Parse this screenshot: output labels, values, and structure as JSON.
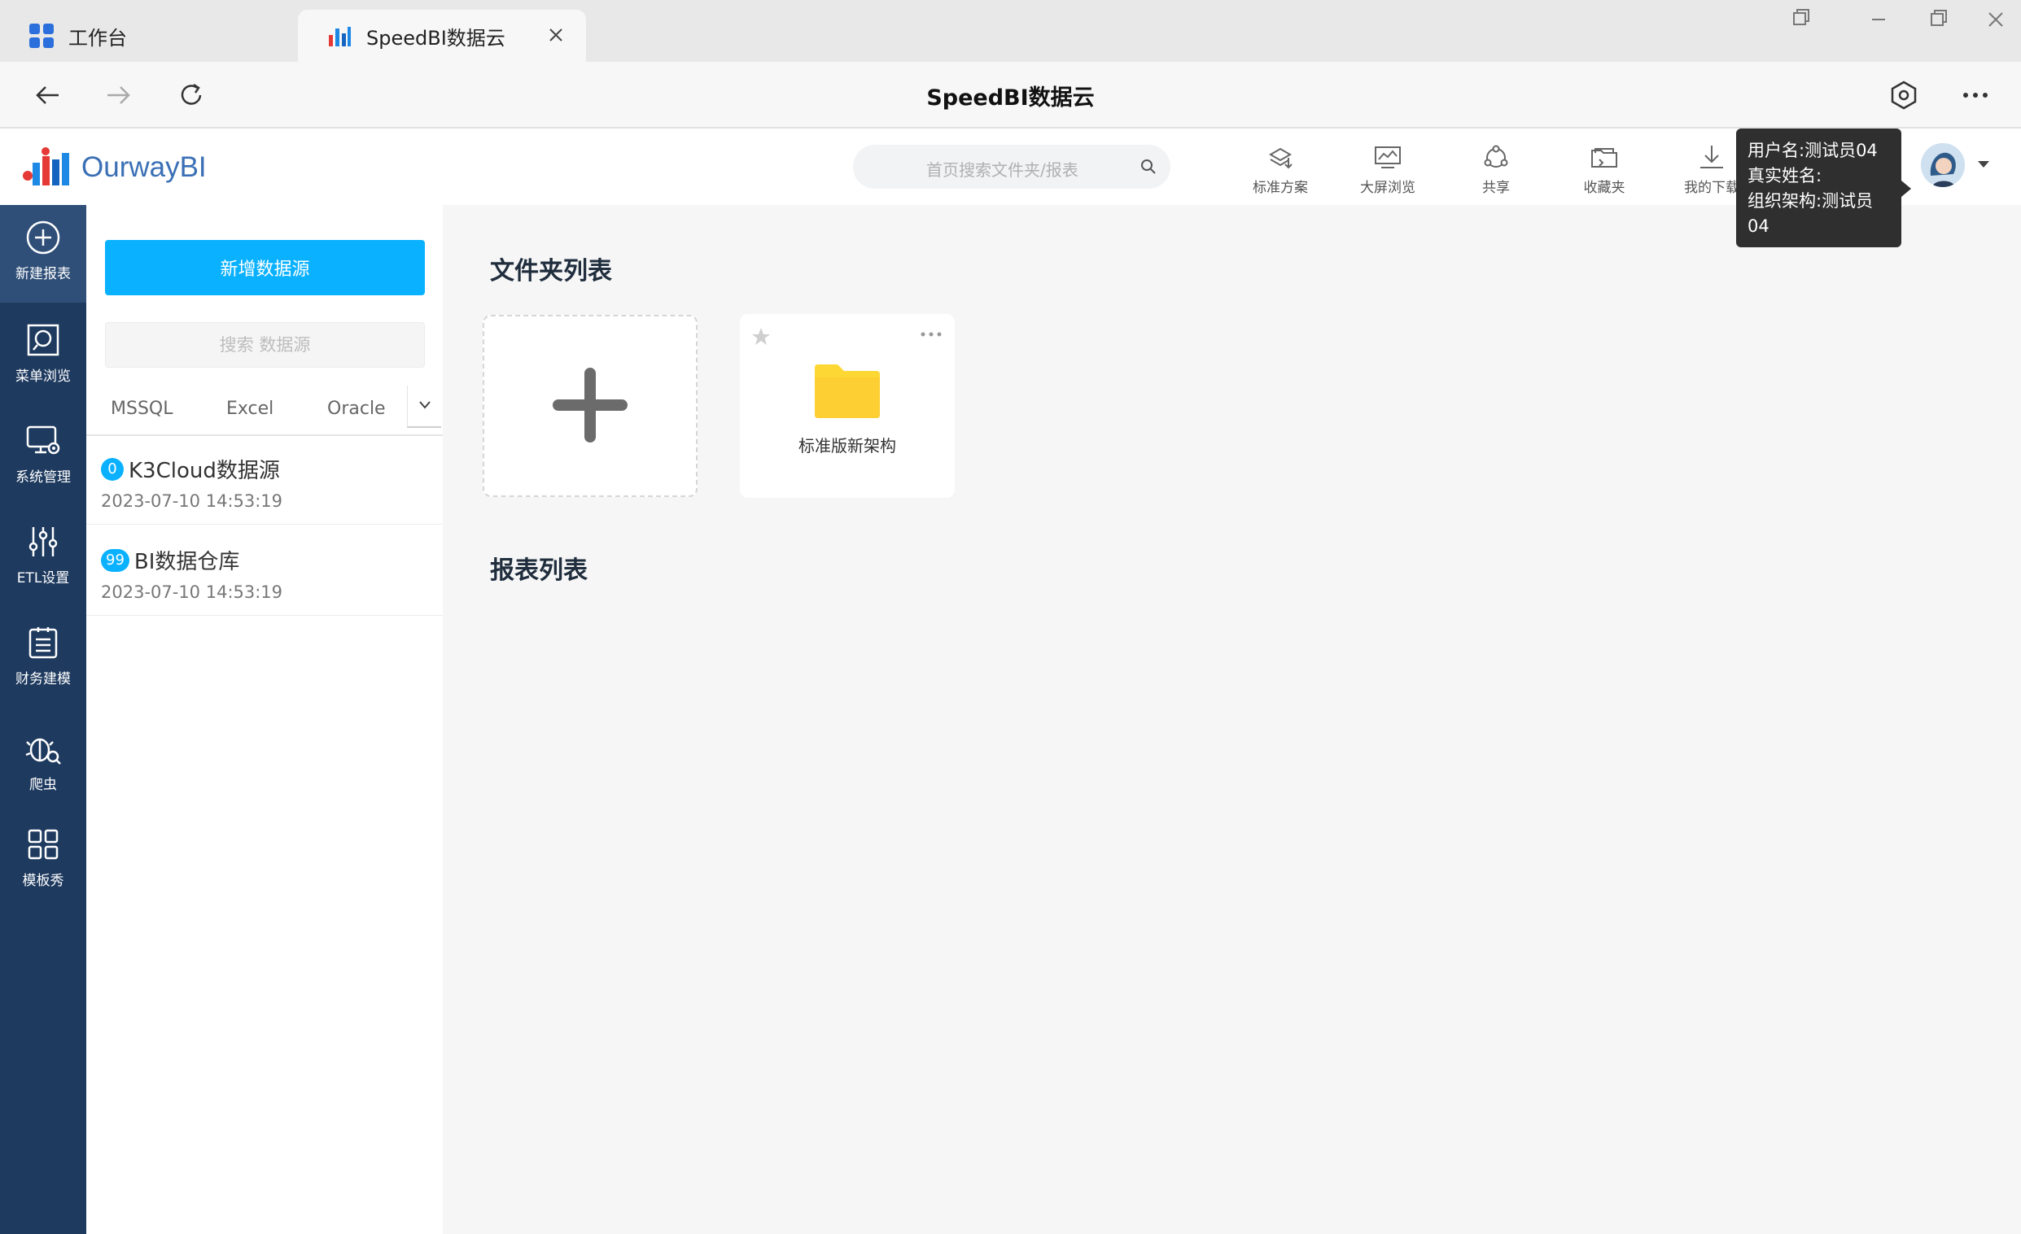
{
  "browser": {
    "tabs": [
      {
        "label": "工作台",
        "icon": "grid-app-icon"
      },
      {
        "label": "SpeedBI数据云",
        "icon": "speedbi-logo-icon"
      }
    ],
    "page_title": "SpeedBI数据云"
  },
  "header": {
    "logo_text": "OurwayBI",
    "search_placeholder": "首页搜索文件夹/报表",
    "tools": [
      {
        "label": "标准方案",
        "icon": "layers-download-icon"
      },
      {
        "label": "大屏浏览",
        "icon": "monitor-chart-icon"
      },
      {
        "label": "共享",
        "icon": "share-icon"
      },
      {
        "label": "收藏夹",
        "icon": "folder-heart-icon"
      },
      {
        "label": "我的下载",
        "icon": "download-icon"
      }
    ]
  },
  "tooltip": {
    "username": "用户名:测试员04",
    "realname": "真实姓名:",
    "org": "组织架构:测试员04"
  },
  "rail": {
    "items": [
      {
        "label": "新建报表",
        "icon": "plus-circle-icon",
        "active": true
      },
      {
        "label": "菜单浏览",
        "icon": "search-square-icon"
      },
      {
        "label": "系统管理",
        "icon": "monitor-gear-icon"
      },
      {
        "label": "ETL设置",
        "icon": "sliders-icon"
      },
      {
        "label": "财务建模",
        "icon": "clipboard-list-icon"
      },
      {
        "label": "爬虫",
        "icon": "bug-search-icon"
      },
      {
        "label": "模板秀",
        "icon": "grid-four-icon"
      }
    ]
  },
  "datasource": {
    "add_button": "新增数据源",
    "search_placeholder": "搜索 数据源",
    "type_tabs": [
      "MSSQL",
      "Excel",
      "Oracle"
    ],
    "items": [
      {
        "badge": "0",
        "name": "K3Cloud数据源",
        "time": "2023-07-10 14:53:19"
      },
      {
        "badge": "99",
        "name": "BI数据仓库",
        "time": "2023-07-10 14:53:19"
      }
    ]
  },
  "main": {
    "folder_section_title": "文件夹列表",
    "folders": [
      {
        "name": "标准版新架构"
      }
    ],
    "report_section_title": "报表列表"
  },
  "colors": {
    "accent": "#0ab1ff",
    "rail": "#1e3a5f",
    "folder": "#fdd835"
  }
}
